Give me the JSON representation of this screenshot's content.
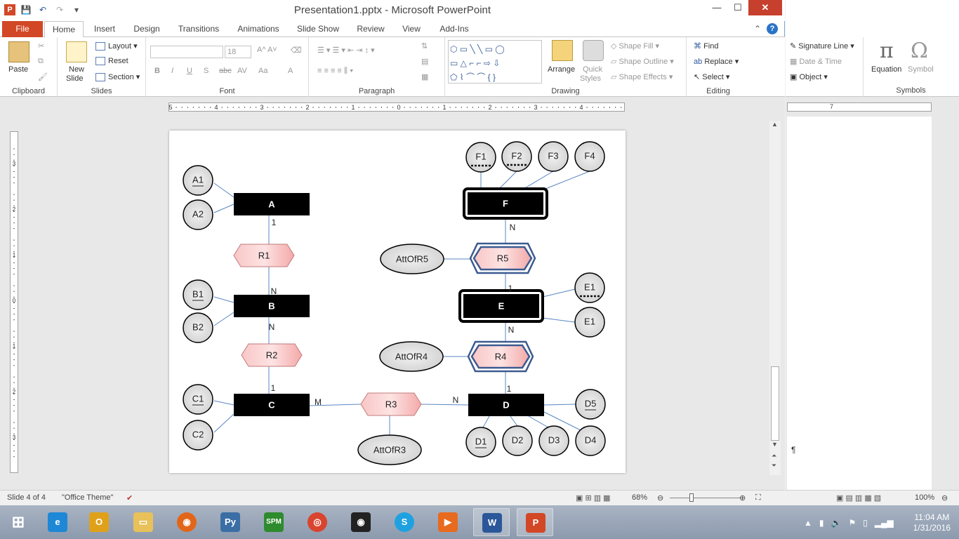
{
  "window": {
    "title": "Presentation1.pptx - Microsoft PowerPoint",
    "app_letter": "P"
  },
  "tabs": [
    "File",
    "Home",
    "Insert",
    "Design",
    "Transitions",
    "Animations",
    "Slide Show",
    "Review",
    "View",
    "Add-Ins"
  ],
  "ribbon": {
    "clipboard": {
      "paste": "Paste",
      "label": "Clipboard"
    },
    "slides": {
      "new_slide": "New",
      "new_slide2": "Slide",
      "layout": "Layout",
      "reset": "Reset",
      "section": "Section",
      "label": "Slides"
    },
    "font": {
      "size": "18",
      "label": "Font",
      "bold": "B",
      "italic": "I",
      "underline": "U",
      "shadow": "S",
      "strike": "abc",
      "spacing": "AV",
      "case": "Aa",
      "color": "A"
    },
    "paragraph": {
      "label": "Paragraph"
    },
    "drawing": {
      "arrange": "Arrange",
      "quick_styles": "Quick",
      "quick_styles2": "Styles",
      "shape_fill": "Shape Fill",
      "shape_outline": "Shape Outline",
      "shape_effects": "Shape Effects",
      "label": "Drawing"
    },
    "editing": {
      "find": "Find",
      "replace": "Replace",
      "select": "Select",
      "label": "Editing"
    }
  },
  "word_ribbon": {
    "signature": "Signature Line",
    "datetime": "Date & Time",
    "object": "Object",
    "equation": "Equation",
    "symbol": "Symbol",
    "label": "Symbols",
    "ruler_mark": "7",
    "pilcrow": "¶"
  },
  "ruler_h": [
    "5",
    "4",
    "3",
    "2",
    "1",
    "0",
    "1",
    "2",
    "3",
    "4"
  ],
  "ruler_v": [
    "3",
    "2",
    "1",
    "0",
    "1",
    "2",
    "3"
  ],
  "diagram": {
    "entities": [
      {
        "id": "A",
        "label": "A"
      },
      {
        "id": "B",
        "label": "B"
      },
      {
        "id": "C",
        "label": "C"
      },
      {
        "id": "D",
        "label": "D"
      },
      {
        "id": "E",
        "label": "E"
      },
      {
        "id": "F",
        "label": "F"
      }
    ],
    "relationships": [
      "R1",
      "R2",
      "R3",
      "R4",
      "R5"
    ],
    "attributes": [
      "A1",
      "A2",
      "B1",
      "B2",
      "C1",
      "C2",
      "D1",
      "D2",
      "D3",
      "D4",
      "D5",
      "E1",
      "E1",
      "F1",
      "F2",
      "F3",
      "F4"
    ],
    "rel_attributes": [
      "AttOfR3",
      "AttOfR4",
      "AttOfR5"
    ],
    "cardinalities": [
      "1",
      "N",
      "N",
      "1",
      "M",
      "N",
      "1",
      "N",
      "1",
      "N"
    ]
  },
  "status": {
    "slide": "Slide 4 of 4",
    "theme": "\"Office Theme\"",
    "zoom": "68%",
    "word_zoom": "100%"
  },
  "clock": {
    "time": "11:04 AM",
    "date": "1/31/2016"
  }
}
